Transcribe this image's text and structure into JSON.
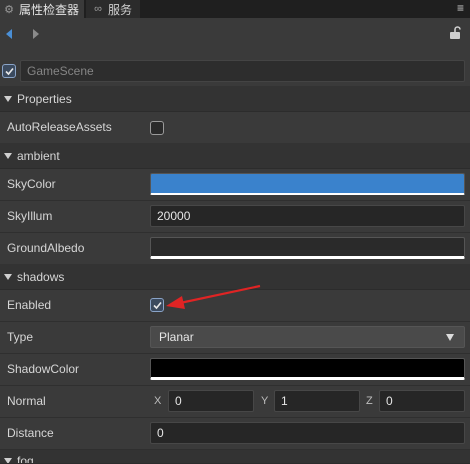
{
  "tabs": [
    {
      "label": "属性检查器",
      "icon": "gear-icon"
    },
    {
      "label": "服务",
      "icon": "link-icon"
    }
  ],
  "node": {
    "name": "GameScene",
    "enabled": true
  },
  "sections": {
    "properties": "Properties",
    "ambient": "ambient",
    "shadows": "shadows",
    "fog": "fog"
  },
  "properties": {
    "auto_release_assets": {
      "label": "AutoReleaseAssets",
      "checked": false
    }
  },
  "ambient": {
    "sky_color": {
      "label": "SkyColor",
      "color": "#3a82cc"
    },
    "sky_illum": {
      "label": "SkyIllum",
      "value": "20000"
    },
    "ground_albedo": {
      "label": "GroundAlbedo",
      "color": "#2a2a2a"
    }
  },
  "shadows": {
    "enabled": {
      "label": "Enabled",
      "checked": true
    },
    "type": {
      "label": "Type",
      "value": "Planar"
    },
    "shadow_color": {
      "label": "ShadowColor",
      "color": "#000000"
    },
    "normal": {
      "label": "Normal",
      "x_label": "X",
      "x": "0",
      "y_label": "Y",
      "y": "1",
      "z_label": "Z",
      "z": "0"
    },
    "distance": {
      "label": "Distance",
      "value": "0"
    }
  },
  "colors": {
    "accent_arrow": "#e02424",
    "sky": "#3a82cc"
  }
}
